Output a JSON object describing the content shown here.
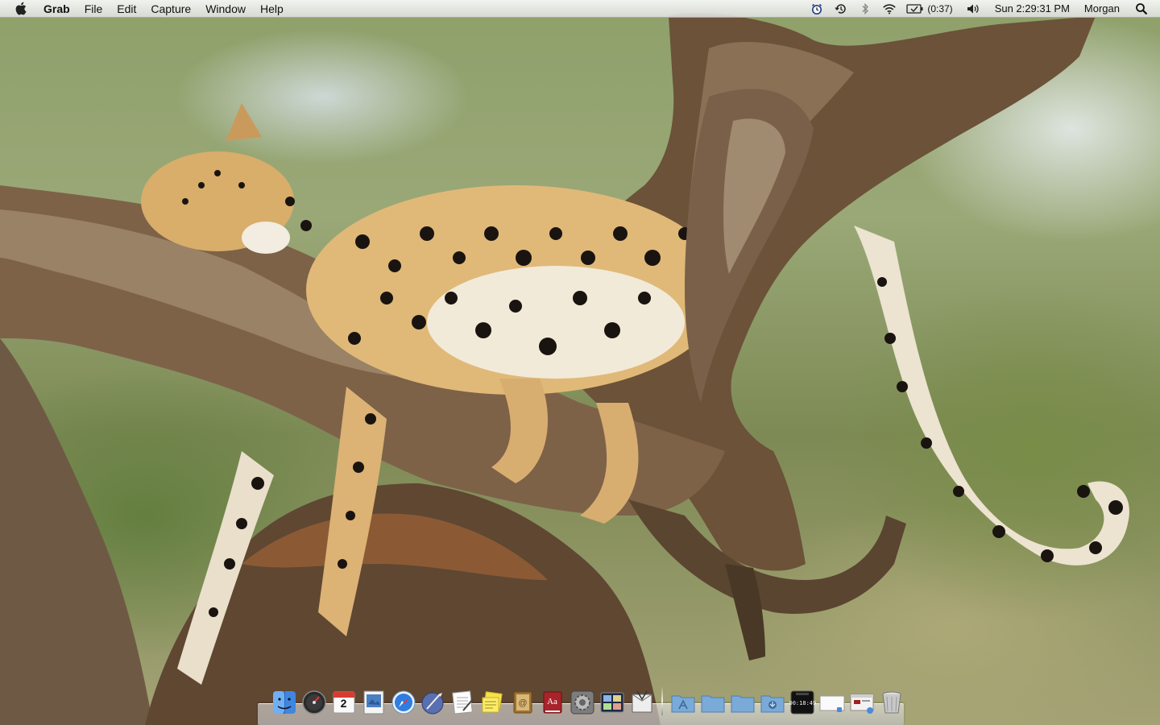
{
  "menubar": {
    "app_name": "Grab",
    "menus": [
      "File",
      "Edit",
      "Capture",
      "Window",
      "Help"
    ],
    "status_icons": [
      "alarm-clock-icon",
      "time-machine-icon",
      "bluetooth-icon",
      "wifi-icon",
      "battery-icon",
      "volume-icon"
    ],
    "battery_text": "(0:37)",
    "clock": "Sun 2:29:31 PM",
    "user": "Morgan"
  },
  "desktop": {
    "wallpaper": "leopard sleeping on a tree branch"
  },
  "dock": {
    "calendar_day": "2",
    "dictionary_text": "Aa",
    "timer_text": "00:18:49",
    "apps": [
      "finder",
      "dashboard",
      "ical",
      "preview",
      "safari",
      "script-editor",
      "textedit",
      "stickies",
      "address-book",
      "dictionary",
      "system-preferences",
      "expose",
      "grab"
    ],
    "stacks": [
      "applications-folder",
      "documents-folder",
      "downloads-folder",
      "shared-folder",
      "timer-widget",
      "document",
      "window-preview",
      "trash"
    ]
  },
  "colors": {
    "menubar_bg": "#eeeeee",
    "dock_shelf": "#c8c8c8",
    "safari_blue": "#2f7de1",
    "folder_blue": "#7aaad8"
  }
}
